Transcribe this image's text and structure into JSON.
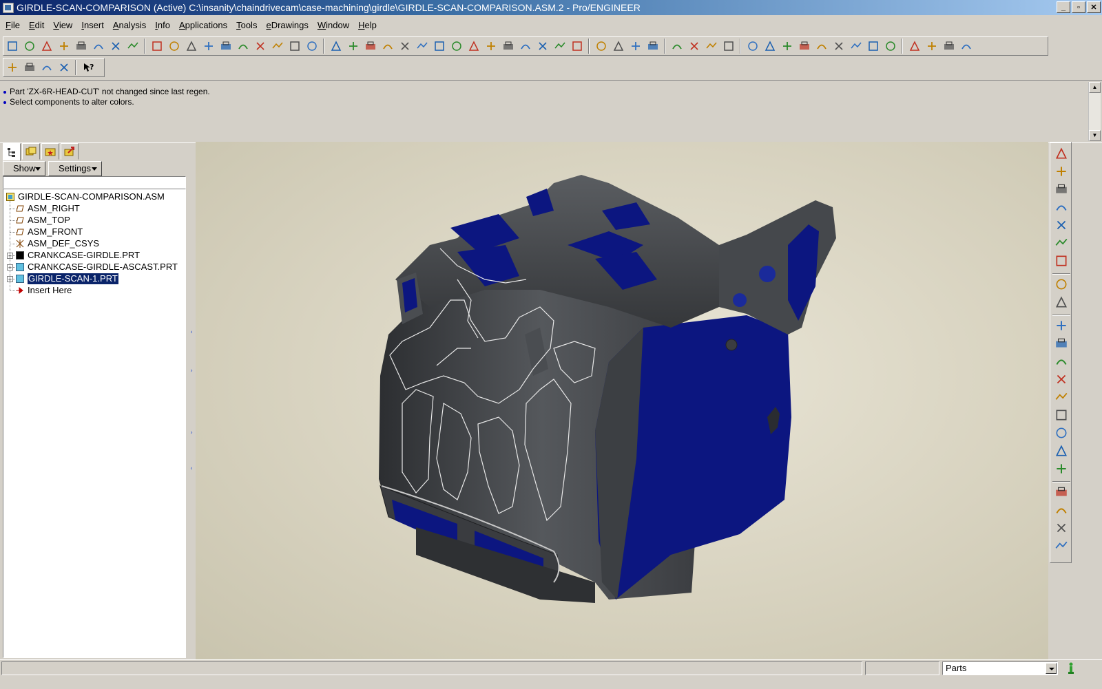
{
  "window": {
    "title": "GIRDLE-SCAN-COMPARISON (Active) C:\\insanity\\chaindrivecam\\case-machining\\girdle\\GIRDLE-SCAN-COMPARISON.ASM.2 - Pro/ENGINEER",
    "buttons": [
      "_",
      "▫",
      "✕"
    ]
  },
  "menubar": {
    "items": [
      "File",
      "Edit",
      "View",
      "Insert",
      "Analysis",
      "Info",
      "Applications",
      "Tools",
      "eDrawings",
      "Window",
      "Help"
    ]
  },
  "toolbar": {
    "icons": [
      "new-assembly-icon",
      "session-icon",
      "new-file-icon",
      "open-folder-icon",
      "save-icon",
      "save-copy-icon",
      "backup-icon",
      "print-icon",
      "undo-icon",
      "redo-icon",
      "cut-icon",
      "copy-icon",
      "paste-icon",
      "paste-special-icon",
      "regenerate-icon",
      "regen-manager-icon",
      "find-icon",
      "selection-box-icon",
      "datum-display-icon",
      "spin-center-icon",
      "pan-icon",
      "layers-icon",
      "view-manager-icon",
      "repaint-icon",
      "zoom-in-icon",
      "zoom-out-icon",
      "refit-icon",
      "orient-icon",
      "saved-views-icon",
      "wireframe-icon",
      "hidden-line-icon",
      "no-hidden-icon",
      "shading-icon",
      "datum-planes-icon",
      "datum-axes-icon",
      "datum-points-icon",
      "coord-systems-icon",
      "measure-icon",
      "section-icon",
      "curvature-icon",
      "model-analysis-icon",
      "mass-props-icon",
      "global-interference-icon",
      "draft-check-icon",
      "reflection-icon",
      "shade-analysis-icon",
      "slope-icon",
      "color-map-icon",
      "offset-icon",
      "edit-definition-icon",
      "sketch-icon",
      "close-window-icon",
      "activate-window-icon",
      "exit-icon"
    ],
    "second_row_icons": [
      "component-icon",
      "assemble-icon",
      "bom-icon",
      "family-table-icon",
      "context-help-icon"
    ]
  },
  "messages": [
    "Part 'ZX-6R-HEAD-CUT' not changed since last regen.",
    "Select components to alter colors."
  ],
  "navigator": {
    "tabs": [
      "model-tree-tab",
      "folder-browser-tab",
      "favorites-tab",
      "connections-tab"
    ],
    "show_label": "Show",
    "settings_label": "Settings",
    "tree": [
      {
        "label": "GIRDLE-SCAN-COMPARISON.ASM",
        "icon": "assembly-icon",
        "level": 0,
        "expandable": false,
        "selected": false
      },
      {
        "label": "ASM_RIGHT",
        "icon": "datum-plane-icon",
        "level": 1,
        "expandable": false,
        "selected": false
      },
      {
        "label": "ASM_TOP",
        "icon": "datum-plane-icon",
        "level": 1,
        "expandable": false,
        "selected": false
      },
      {
        "label": "ASM_FRONT",
        "icon": "datum-plane-icon",
        "level": 1,
        "expandable": false,
        "selected": false
      },
      {
        "label": "ASM_DEF_CSYS",
        "icon": "csys-icon",
        "level": 1,
        "expandable": false,
        "selected": false
      },
      {
        "label": "CRANKCASE-GIRDLE.PRT",
        "icon": "part-dark-icon",
        "level": 1,
        "expandable": true,
        "selected": false
      },
      {
        "label": "CRANKCASE-GIRDLE-ASCAST.PRT",
        "icon": "part-icon",
        "level": 1,
        "expandable": true,
        "selected": false
      },
      {
        "label": "GIRDLE-SCAN-1.PRT",
        "icon": "part-icon",
        "level": 1,
        "expandable": true,
        "selected": true
      },
      {
        "label": "Insert Here",
        "icon": "insert-here-arrow-icon",
        "level": 1,
        "expandable": false,
        "selected": false
      }
    ]
  },
  "right_toolbar": {
    "icons": [
      "datum-point-icon",
      "datum-curve-sketch-icon",
      "datum-plane-tool-icon",
      "datum-axis-tool-icon",
      "datum-curve-tool-icon",
      "csys-tool-icon",
      "analysis-feature-icon",
      "extrude-icon",
      "revolve-icon",
      "sweep-icon",
      "blend-icon",
      "hole-icon",
      "round-icon",
      "chamfer-icon",
      "shell-icon",
      "rib-icon",
      "draft-icon",
      "mirror-icon",
      "merge-icon",
      "trim-icon",
      "pattern-icon",
      "table-icon"
    ]
  },
  "statusbar": {
    "filter_value": "Parts"
  },
  "colors": {
    "title_active": "#0a246a",
    "selection": "#0a246a",
    "model_gray": "#434649",
    "model_blue": "#0c1680",
    "scan_outline": "#e8e8e8",
    "viewport_bg": "#dcd7c4"
  }
}
